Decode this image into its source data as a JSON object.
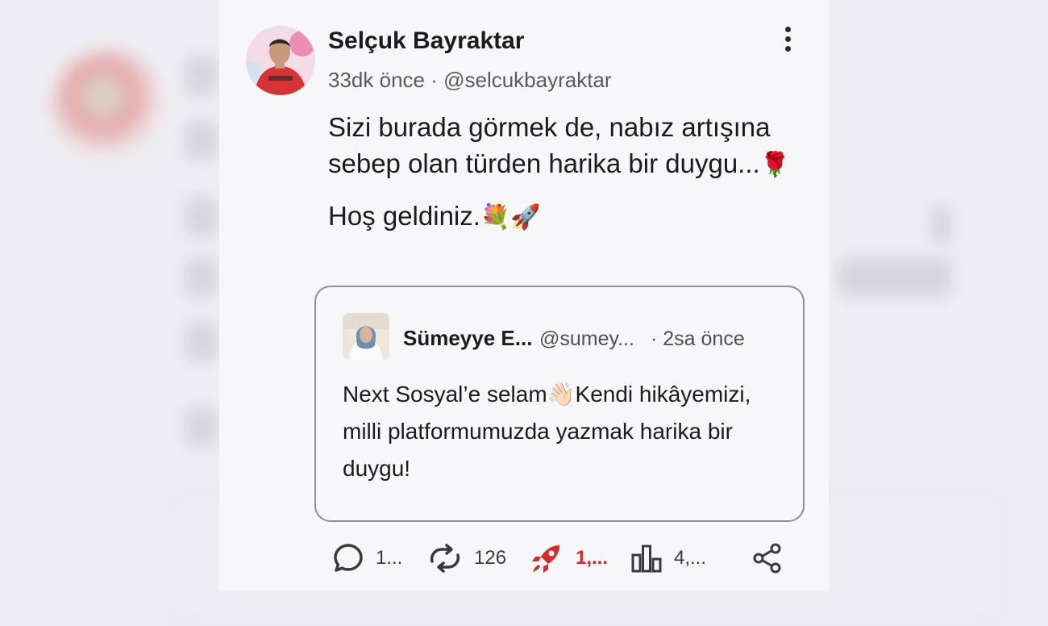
{
  "post": {
    "author_name": "Selçuk Bayraktar",
    "meta": "33dk önce · @selcukbayraktar",
    "paragraph_1": "Sizi burada görmek de, nabız artışına sebep olan türden harika bir duygu...",
    "paragraph_1_emoji": "🌹",
    "paragraph_2": "Hoş geldiniz.",
    "paragraph_2_emoji": "💐🚀"
  },
  "quote": {
    "name": "Sümeyye E...",
    "handle": "@sumey...",
    "time": "· 2sa önce",
    "text_before_emoji": "Next Sosyal’e selam",
    "emoji": "👋🏻",
    "text_after_emoji": "Kendi hikâyemizi, milli platformumuzda yazmak harika bir duygu!"
  },
  "actions": {
    "reply_count": "1...",
    "repost_count": "126",
    "boost_count": "1,...",
    "views_count": "4,..."
  },
  "colors": {
    "accent_red": "#d62a2a",
    "panel_bg": "#f7f7fa",
    "card_border": "#8e8e93"
  },
  "icons": [
    "more-vertical-icon",
    "comment-icon",
    "repost-icon",
    "rocket-icon",
    "bar-chart-icon",
    "share-icon"
  ]
}
